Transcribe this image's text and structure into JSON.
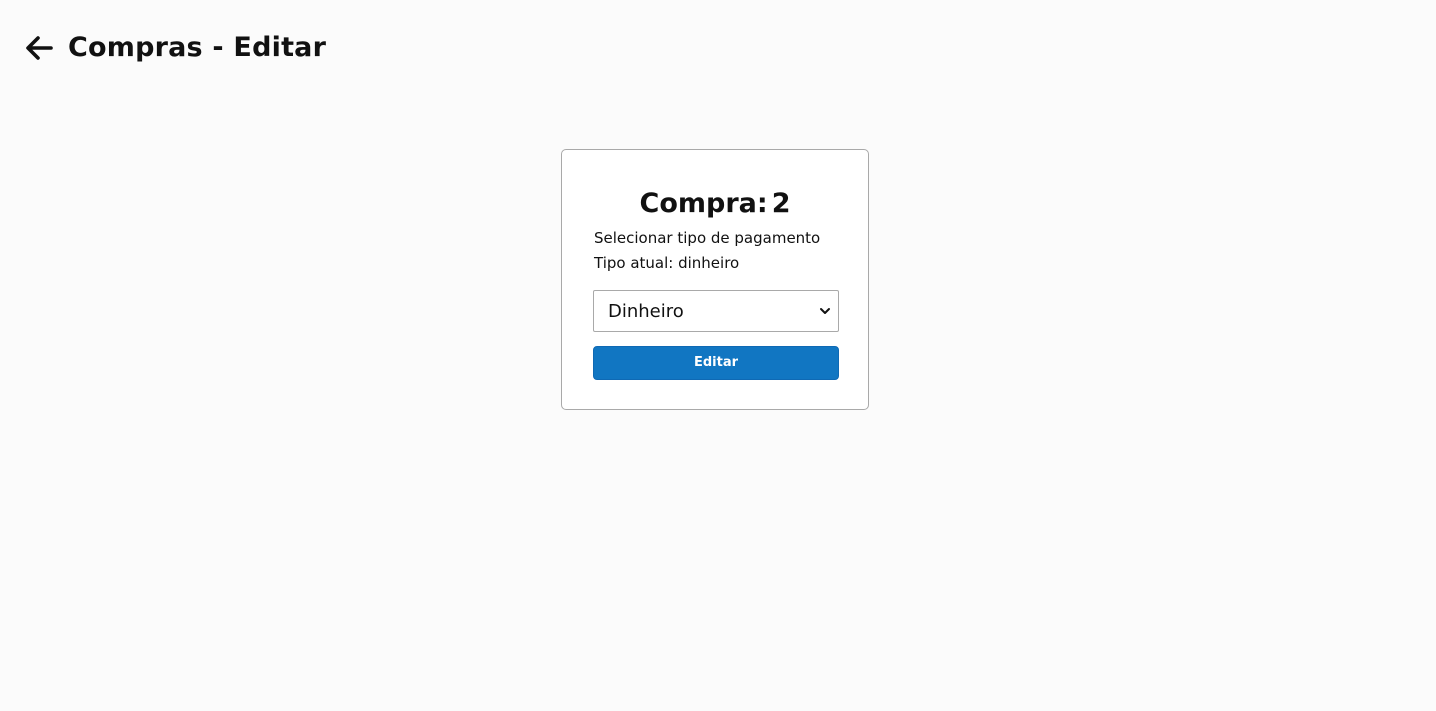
{
  "header": {
    "back_icon": "arrow-left-icon",
    "title": "Compras - Editar"
  },
  "card": {
    "title_label": "Compra:",
    "title_number": "2",
    "select_label": "Selecionar tipo de pagamento",
    "current_type": "Tipo atual: dinheiro",
    "payment_select": {
      "selected": "Dinheiro",
      "chevron_icon": "chevron-down-icon"
    },
    "submit_label": "Editar"
  },
  "colors": {
    "background": "#fbfbfb",
    "card_border": "#a9a9a9",
    "button": "#1176c2",
    "text": "#111111"
  }
}
